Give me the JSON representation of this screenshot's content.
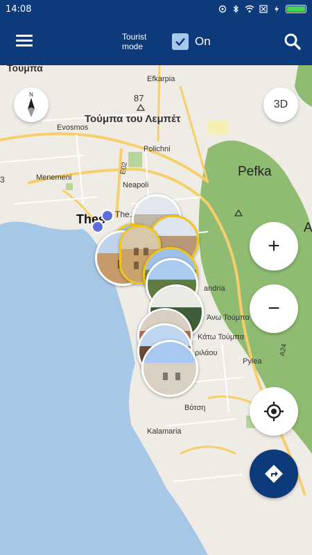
{
  "status_bar": {
    "time": "14:08"
  },
  "app_bar": {
    "tourist_mode_label": "Tourist mode",
    "toggle_state": "On"
  },
  "map": {
    "labels": {
      "toumpa_top": "Τουμπα",
      "efkarpia": "Efkarpia",
      "elevation": "87",
      "toumpa_lembet": "Τούμπα του Λεμπέτ",
      "evosmos": "Evosmos",
      "polichni": "Polichni",
      "e02": "E02",
      "menemeni": "Menemeni",
      "neapoli": "Neapoli",
      "pefka": "Pefka",
      "thes": "Thes",
      "railway": "The…ew Railwa",
      "a_right": "A",
      "andria": "andria",
      "ano_toumpa": "Άνω Τούμπα",
      "kato_toumpa": "Κάτω Τούμπα",
      "pilaiou": "ριλάου",
      "pylea": "Pylea",
      "a24": "A24",
      "voti": "Βότση",
      "kalamaria": "Kalamaria",
      "three": "3"
    },
    "compass_letter": "N",
    "three_d_label": "3D",
    "zoom_in_label": "+",
    "zoom_out_label": "−"
  },
  "colors": {
    "primary": "#0d3a7a",
    "sea": "#a7c7e6",
    "land": "#efece6",
    "park": "#8fbc72",
    "road_major": "#f7cf6a",
    "marker_border": "#f2c51c"
  }
}
